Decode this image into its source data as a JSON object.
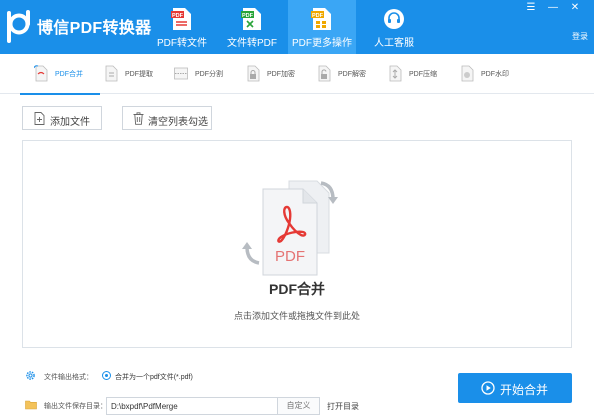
{
  "app": {
    "title": "博信PDF转换器"
  },
  "header": {
    "tabs": [
      {
        "label": "PDF转文件",
        "icon": "pdf-to-file-icon"
      },
      {
        "label": "文件转PDF",
        "icon": "file-to-pdf-icon"
      },
      {
        "label": "PDF更多操作",
        "icon": "pdf-more-icon",
        "active": true
      },
      {
        "label": "人工客服",
        "icon": "headset-icon"
      }
    ],
    "login_label": "登录"
  },
  "subtabs": [
    {
      "label": "PDF合并",
      "active": true
    },
    {
      "label": "PDF提取"
    },
    {
      "label": "PDF分割"
    },
    {
      "label": "PDF加密"
    },
    {
      "label": "PDF解密"
    },
    {
      "label": "PDF压缩"
    },
    {
      "label": "PDF水印"
    }
  ],
  "toolbar": {
    "add_file_label": "添加文件",
    "clear_list_label": "清空列表勾选"
  },
  "dropzone": {
    "title": "PDF合并",
    "hint": "点击添加文件或拖拽文件到此处",
    "doc_text": "PDF"
  },
  "bottom": {
    "format_label": "文件输出格式：",
    "format_option": "合并为一个pdf文件(*.pdf)",
    "save_dir_label": "输出文件保存目录：",
    "save_dir_value": "D:\\bxpdf\\PdfMerge",
    "custom_label": "自定义",
    "open_dir_label": "打开目录",
    "start_label": "开始合并"
  },
  "colors": {
    "accent": "#1a8fe9",
    "active_tab": "#3aa6f5",
    "pdf_red": "#e53935"
  }
}
